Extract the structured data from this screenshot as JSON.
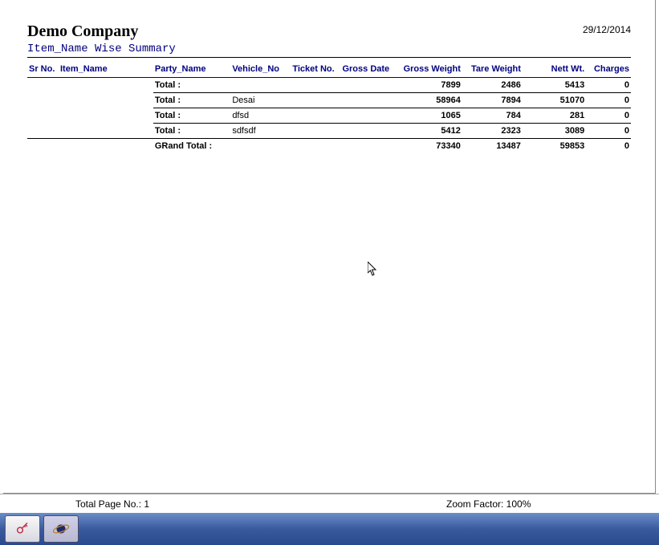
{
  "header": {
    "company_name": "Demo Company",
    "report_date": "29/12/2014",
    "report_title": "Item_Name Wise Summary"
  },
  "columns": {
    "sr_no": "Sr No.",
    "item_name": "Item_Name",
    "party_name": "Party_Name",
    "vehicle_no": "Vehicle_No",
    "ticket_no": "Ticket No.",
    "gross_date": "Gross Date",
    "gross_weight": "Gross Weight",
    "tare_weight": "Tare Weight",
    "nett_wt": "Nett Wt.",
    "charges": "Charges"
  },
  "rows": [
    {
      "label": "Total :",
      "vehicle": "",
      "gross_weight": "7899",
      "tare_weight": "2486",
      "nett_wt": "5413",
      "charges": "0"
    },
    {
      "label": "Total :",
      "vehicle": "Desai",
      "gross_weight": "58964",
      "tare_weight": "7894",
      "nett_wt": "51070",
      "charges": "0"
    },
    {
      "label": "Total :",
      "vehicle": "dfsd",
      "gross_weight": "1065",
      "tare_weight": "784",
      "nett_wt": "281",
      "charges": "0"
    },
    {
      "label": "Total :",
      "vehicle": "sdfsdf",
      "gross_weight": "5412",
      "tare_weight": "2323",
      "nett_wt": "3089",
      "charges": "0"
    }
  ],
  "grand_total": {
    "label": "GRand Total :",
    "gross_weight": "73340",
    "tare_weight": "13487",
    "nett_wt": "59853",
    "charges": "0"
  },
  "status": {
    "page_label": "Total Page No.: 1",
    "zoom_label": "Zoom Factor: 100%"
  }
}
